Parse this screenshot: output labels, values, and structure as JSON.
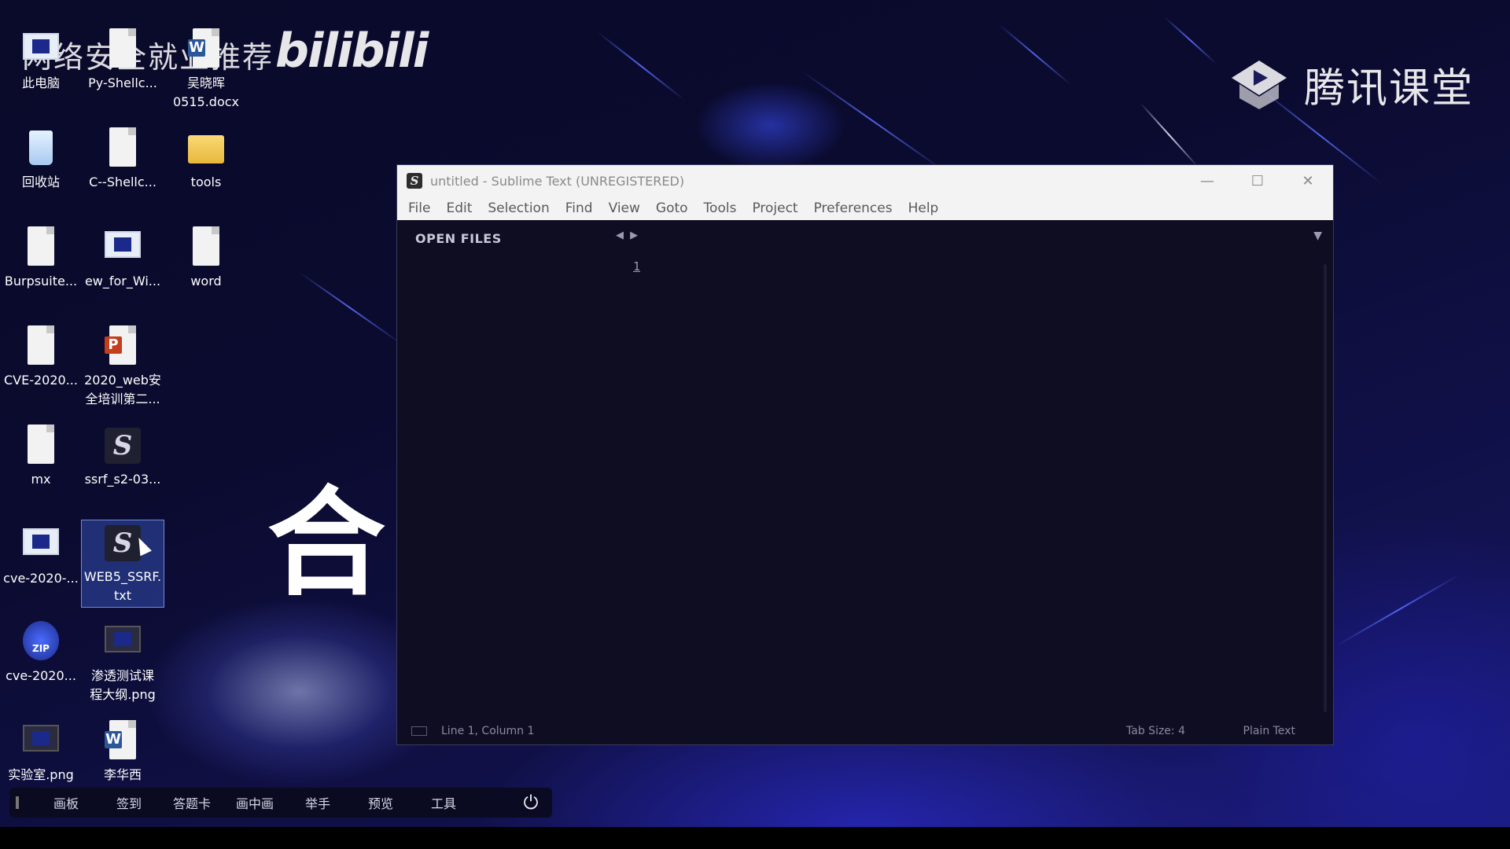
{
  "watermarks": {
    "left_text": "网络安全就业推荐",
    "bilibili": "bilibili",
    "tencent": "腾讯课堂",
    "center_char": "合"
  },
  "desktop": {
    "icons": [
      {
        "label": "此电脑",
        "icon": "computer-icon"
      },
      {
        "label": "Py-Shellc...",
        "icon": "file-icon"
      },
      {
        "label": "吴晓晖\n0515.docx",
        "icon": "word-doc-icon"
      },
      {
        "label": "回收站",
        "icon": "recycle-bin-icon"
      },
      {
        "label": "C--Shellc...",
        "icon": "file-icon"
      },
      {
        "label": "tools",
        "icon": "folder-icon"
      },
      {
        "label": "Burpsuite...",
        "icon": "file-icon"
      },
      {
        "label": "ew_for_Wi...",
        "icon": "app-window-icon"
      },
      {
        "label": "word",
        "icon": "file-icon"
      },
      {
        "label": "CVE-2020...",
        "icon": "file-icon"
      },
      {
        "label": "2020_web安\n全培训第二...",
        "icon": "powerpoint-icon"
      },
      {
        "label": "mx",
        "icon": "file-icon"
      },
      {
        "label": "ssrf_s2-03...",
        "icon": "sublime-file-icon"
      },
      {
        "label": "cve-2020-...",
        "icon": "app-window-icon"
      },
      {
        "label": "WEB5_SSRF.\ntxt",
        "icon": "sublime-file-icon",
        "selected": true
      },
      {
        "label": "cve-2020...",
        "icon": "zip-icon"
      },
      {
        "label": "渗透测试课\n程大纲.png",
        "icon": "image-file-icon"
      },
      {
        "label": "实验室.png",
        "icon": "image-file-icon"
      },
      {
        "label": "李华西",
        "icon": "word-doc-icon"
      }
    ]
  },
  "sublime": {
    "window_title": "untitled - Sublime Text (UNREGISTERED)",
    "app_icon_letter": "S",
    "controls": {
      "minimize": "—",
      "maximize": "☐",
      "close": "✕"
    },
    "menu": [
      "File",
      "Edit",
      "Selection",
      "Find",
      "View",
      "Goto",
      "Tools",
      "Project",
      "Preferences",
      "Help"
    ],
    "sidebar_header": "OPEN FILES",
    "nav_arrows": "◀ ▶",
    "tab_dropdown": "▼",
    "line_numbers": [
      "1"
    ],
    "status": {
      "position": "Line 1, Column 1",
      "tab_size": "Tab Size: 4",
      "syntax": "Plain Text"
    }
  },
  "class_toolbar": {
    "buttons": [
      "画板",
      "签到",
      "答题卡",
      "画中画",
      "举手",
      "预览",
      "工具"
    ],
    "power_icon": "⏻"
  }
}
